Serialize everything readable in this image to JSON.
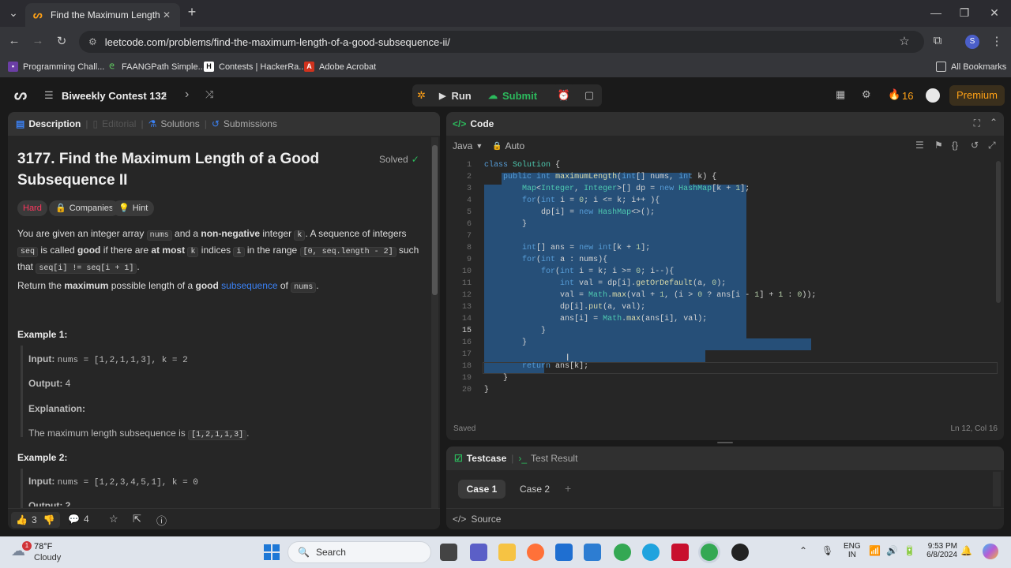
{
  "browser": {
    "tab_title": "Find the Maximum Length of a",
    "url": "leetcode.com/problems/find-the-maximum-length-of-a-good-subsequence-ii/",
    "profile_initial": "S",
    "bookmarks": [
      "Programming Chall...",
      "FAANGPath Simple...",
      "Contests | HackerRa...",
      "Adobe Acrobat"
    ],
    "all_bookmarks": "All Bookmarks"
  },
  "topbar": {
    "contest": "Biweekly Contest 132",
    "run_label": "Run",
    "submit_label": "Submit",
    "streak": "16",
    "premium_label": "Premium"
  },
  "left_tabs": [
    "Description",
    "Editorial",
    "Solutions",
    "Submissions"
  ],
  "problem": {
    "title_line1": "3177. Find the Maximum Length of a Good",
    "title_line2": "Subsequence II",
    "solved_label": "Solved",
    "difficulty": "Hard",
    "companies_label": "Companies",
    "hint_label": "Hint",
    "p1": {
      "t1": "You are given an integer array ",
      "c1": "nums",
      "t2": " and a ",
      "b1": "non-negative",
      "t3": " integer ",
      "c2": "k",
      "t4": ". A sequence of integers ",
      "c3": "seq",
      "t5": " is called ",
      "b2": "good",
      "t6": " if there are ",
      "b3": "at most",
      "t7": " ",
      "c4": "k",
      "t8": " indices ",
      "c5": "i",
      "t9": " in the range ",
      "c6": "[0, seq.length - 2]",
      "t10": " such that ",
      "c7": "seq[i] != seq[i + 1]",
      "t11": "."
    },
    "p2": {
      "t1": "Return the ",
      "b1": "maximum",
      "t2": " possible length of a ",
      "b2": "good",
      "t3": " ",
      "link": "subsequence",
      "t4": " of ",
      "c1": "nums",
      "t5": "."
    },
    "ex1": {
      "heading": "Example 1:",
      "input_label": "Input:",
      "input": "nums = [1,2,1,1,3], k = 2",
      "output_label": "Output:",
      "output": "4",
      "explanation_label": "Explanation:",
      "explanation": "The maximum length subsequence is ",
      "explanation_code": "[1,2,1,1,3]",
      "explanation_end": "."
    },
    "ex2": {
      "heading": "Example 2:",
      "input_label": "Input:",
      "input": "nums = [1,2,3,4,5,1], k = 0",
      "output_partial": "Output: 2"
    },
    "likes": "3",
    "comments": "4"
  },
  "code_panel": {
    "title": "Code",
    "language": "Java",
    "mode": "Auto",
    "status": "Saved",
    "cursor": "Ln 12, Col 16",
    "line_numbers": [
      "1",
      "2",
      "3",
      "4",
      "5",
      "6",
      "7",
      "8",
      "9",
      "10",
      "11",
      "12",
      "13",
      "14",
      "15",
      "16",
      "17",
      "18",
      "19",
      "20"
    ],
    "lines": [
      "class Solution {",
      "    public int maximumLength(int[] nums, int k) {",
      "        Map<Integer, Integer>[] dp = new HashMap[k + 1];",
      "        for(int i = 0; i <= k; i++ ){",
      "            dp[i] = new HashMap<>();",
      "        }",
      "",
      "        int[] ans = new int[k + 1];",
      "        for(int a : nums){",
      "            for(int i = k; i >= 0; i--){",
      "                int val = dp[i].getOrDefault(a, 0);",
      "                val = Math.max(val + 1, (i > 0 ? ans[i - 1] + 1 : 0));",
      "                dp[i].put(a, val);",
      "                ans[i] = Math.max(ans[i], val);",
      "            }",
      "        }",
      "",
      "        return ans[k];",
      "    }",
      "}"
    ]
  },
  "testcase_panel": {
    "tab1": "Testcase",
    "tab2": "Test Result",
    "cases": [
      "Case 1",
      "Case 2"
    ],
    "source_label": "Source"
  },
  "taskbar": {
    "weather_temp": "78°F",
    "weather_desc": "Cloudy",
    "weather_badge": "1",
    "search_label": "Search",
    "lang1": "ENG",
    "lang2": "IN",
    "time": "9:53 PM",
    "date": "6/8/2024"
  },
  "colors": {
    "accent_orange": "#ffa116",
    "submit_green": "#2cbb5d",
    "hard_red": "#ff375f",
    "link_blue": "#3b82f6",
    "selection": "#264f78"
  }
}
